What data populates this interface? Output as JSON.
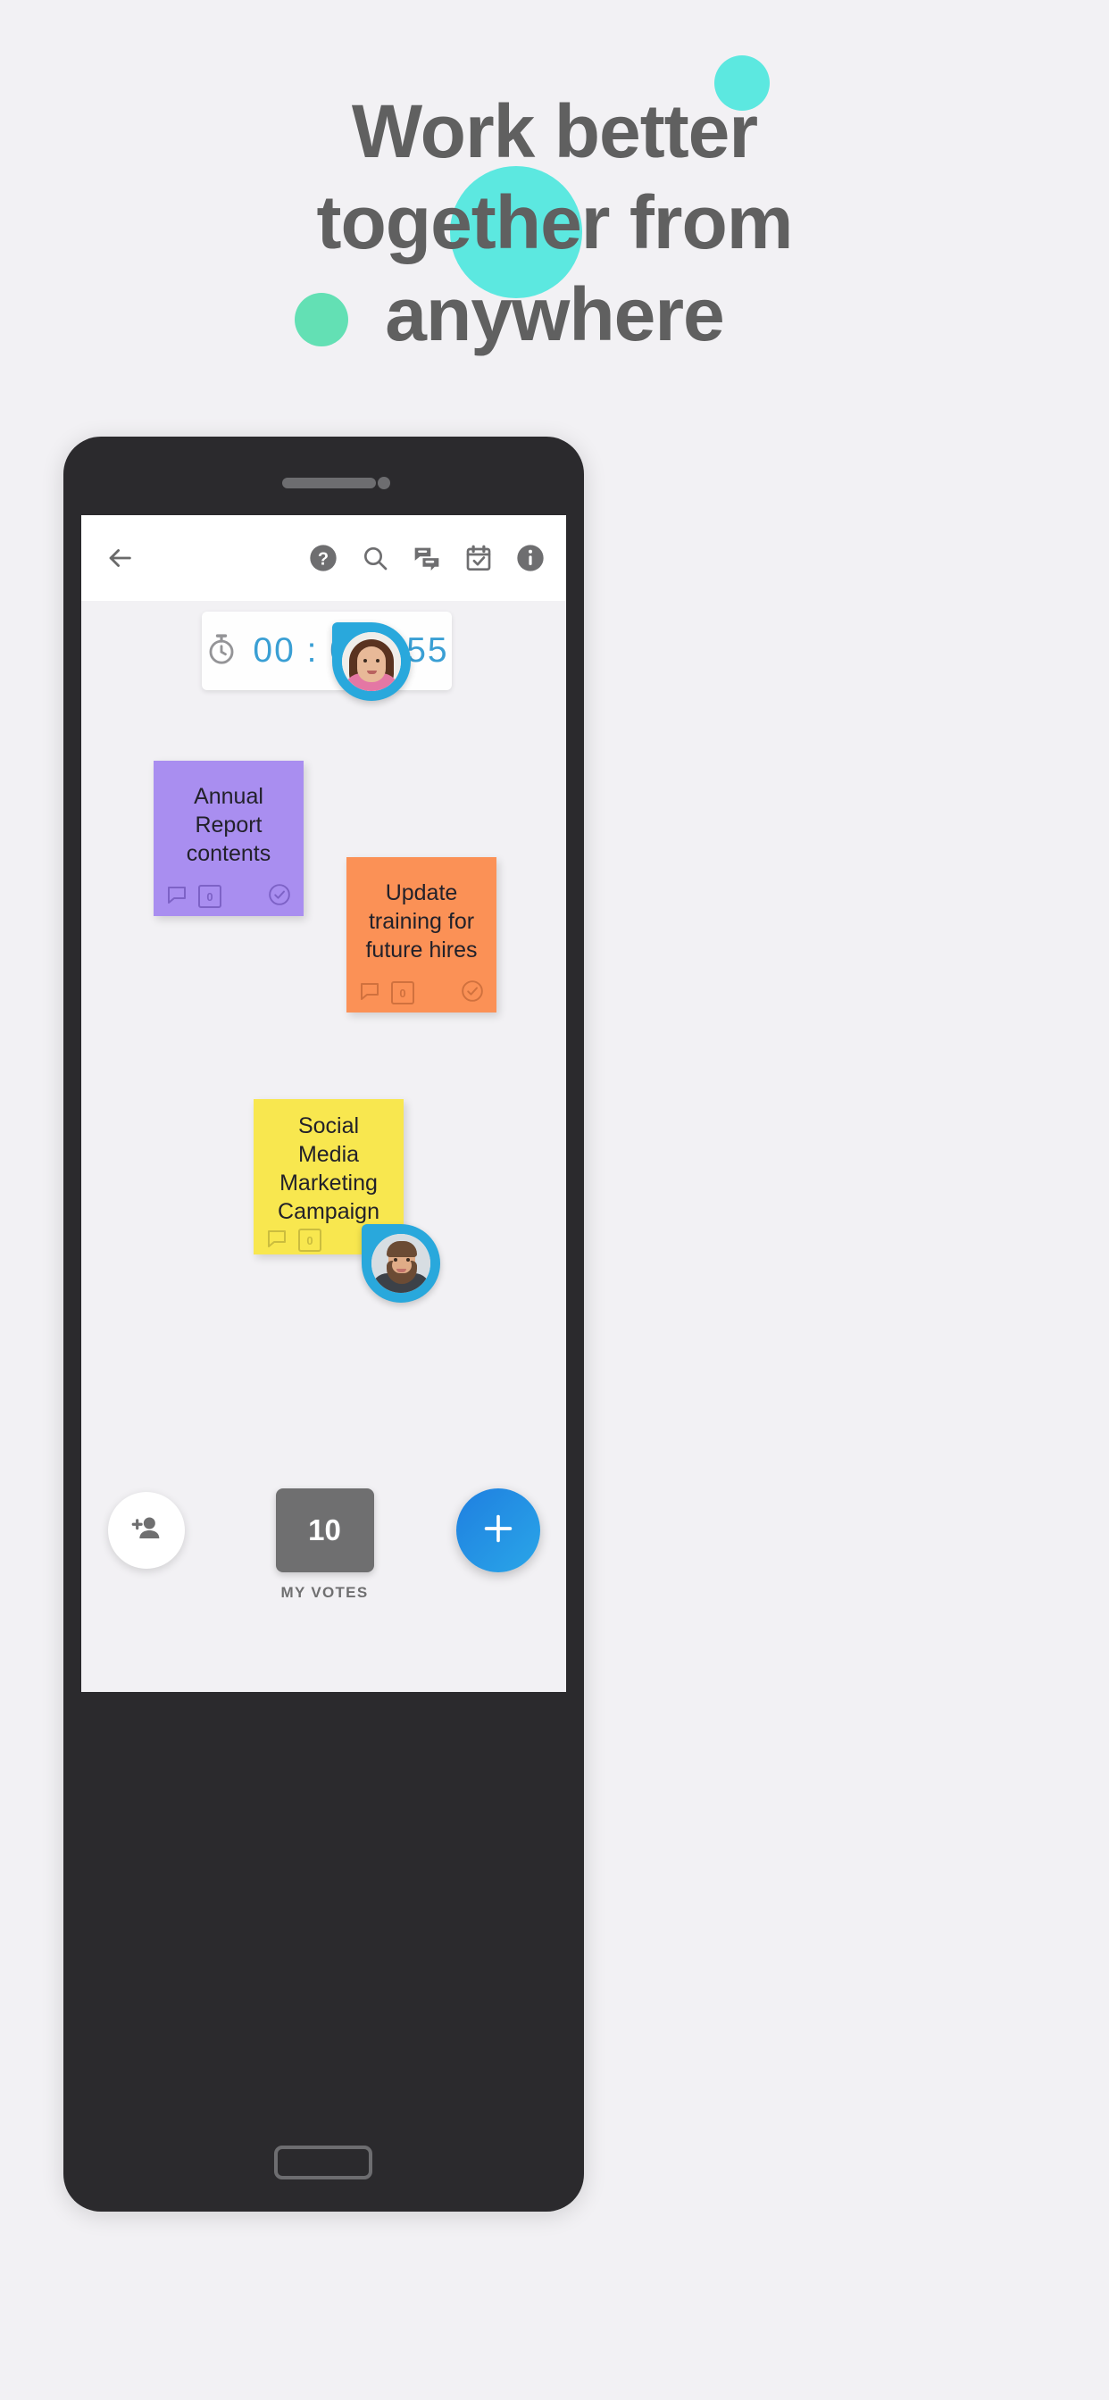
{
  "hero": {
    "title_line_1": "Work better",
    "title_line_2": "together from",
    "title_line_3": "anywhere",
    "title_color": "#606060",
    "background_color": "#f2f1f4",
    "blob_color_teal": "#5ce8e0",
    "blob_color_green": "#63e0b4"
  },
  "appbar": {
    "back_label": "back-arrow",
    "icons": [
      {
        "name": "help-icon",
        "label": "Help"
      },
      {
        "name": "search-icon",
        "label": "Search"
      },
      {
        "name": "comments-icon",
        "label": "Comments"
      },
      {
        "name": "agenda-icon",
        "label": "Agenda"
      },
      {
        "name": "info-icon",
        "label": "Info"
      }
    ]
  },
  "timer": {
    "icon": "stopwatch-icon",
    "value": "00 : 09 : 55",
    "hours": "00",
    "minutes": "09",
    "seconds": "55",
    "text_color": "#3a9fd4"
  },
  "notes": [
    {
      "id": "note-annual-report",
      "text": "Annual Report contents",
      "color": "#a98ef0",
      "comment_count": "0",
      "comment_icon": "comment-icon",
      "count_icon": "vote-count-icon",
      "done_icon": "check-circle-icon"
    },
    {
      "id": "note-update-training",
      "text": "Update training for future hires",
      "color": "#fb9156",
      "comment_count": "0",
      "comment_icon": "comment-icon",
      "count_icon": "vote-count-icon",
      "done_icon": "check-circle-icon"
    },
    {
      "id": "note-social-media",
      "text": "Social Media Marketing Campaign",
      "color": "#f8e74f",
      "comment_count": "0",
      "comment_icon": "comment-icon",
      "count_icon": "vote-count-icon",
      "done_icon": "check-circle-icon"
    }
  ],
  "avatars": [
    {
      "id": "avatar-female",
      "ring_color": "#29a8dc"
    },
    {
      "id": "avatar-male",
      "ring_color": "#29a8dc"
    }
  ],
  "bottom_bar": {
    "add_person_icon": "add-person-icon",
    "votes_count": "10",
    "votes_label": "MY VOTES",
    "votes_box_color": "#6f6f70",
    "fab_icon": "plus-icon",
    "fab_color_start": "#1f7fe0",
    "fab_color_end": "#2aa6e8"
  }
}
